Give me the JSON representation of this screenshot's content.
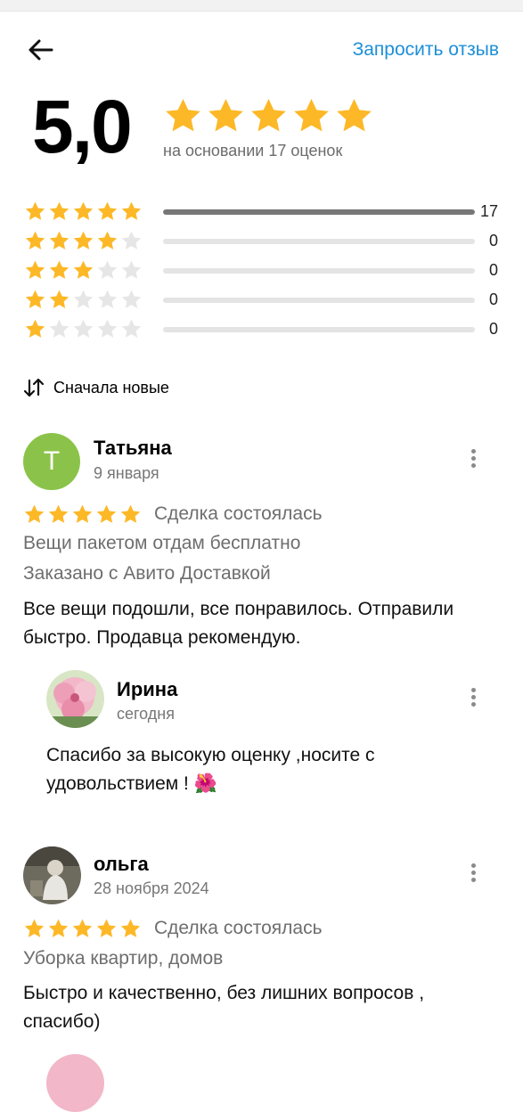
{
  "header": {
    "request_label": "Запросить отзыв"
  },
  "summary": {
    "rating": "5,0",
    "based_on": "на основании 17 оценок"
  },
  "distribution": [
    {
      "stars": 5,
      "count": "17",
      "fraction": 1.0
    },
    {
      "stars": 4,
      "count": "0",
      "fraction": 0
    },
    {
      "stars": 3,
      "count": "0",
      "fraction": 0
    },
    {
      "stars": 2,
      "count": "0",
      "fraction": 0
    },
    {
      "stars": 1,
      "count": "0",
      "fraction": 0
    }
  ],
  "sort": {
    "label": "Сначала новые"
  },
  "colors": {
    "star": "#fdb827",
    "star_empty": "#e6e6e6",
    "link": "#1d8fd6",
    "avatar_t": "#8bc34a"
  },
  "reviews": [
    {
      "avatar_letter": "Т",
      "author": "Татьяна",
      "date": "9 января",
      "rating": 5,
      "deal": "Сделка состоялась",
      "item": "Вещи пакетом отдам бесплатно",
      "delivery": "Заказано с Авито Доставкой",
      "text_line1": "Все вещи подошли, все понравилось. Отправили",
      "text_line2": "быстро. Продавца рекомендую.",
      "reply": {
        "author": "Ирина",
        "date": "сегодня",
        "text_line1": "Спасибо за высокую оценку ,носите с",
        "text_line2": "удовольствием ! 🌺"
      }
    },
    {
      "author": "ольга",
      "date": "28 ноября 2024",
      "rating": 5,
      "deal": "Сделка состоялась",
      "item": "Уборка квартир, домов",
      "text_line1": "Быстро и качественно, без лишних вопросов ,",
      "text_line2": "спасибо)"
    }
  ]
}
